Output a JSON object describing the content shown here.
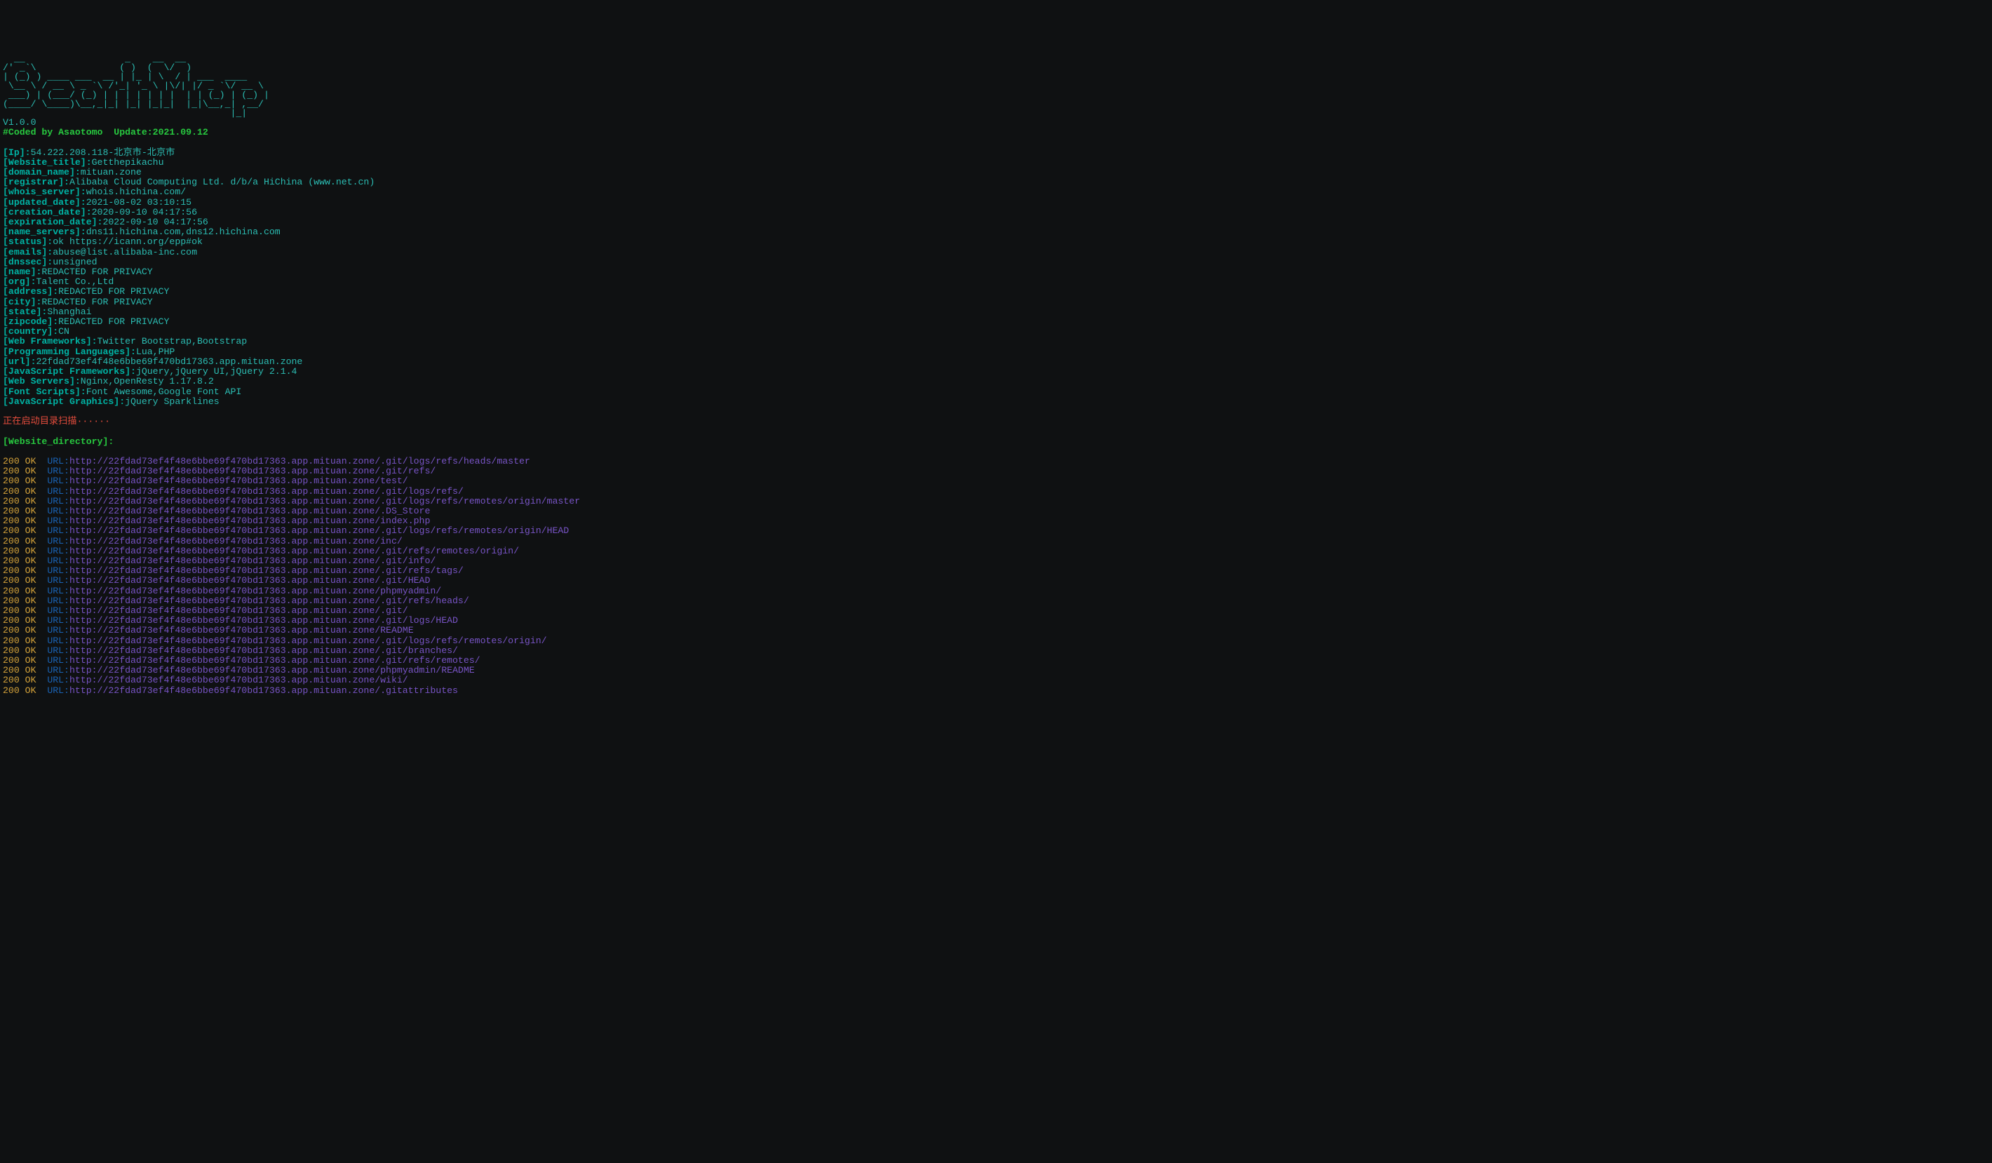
{
  "ascii_art": "  __                  _    __  __\n/' _`\\               ( )  (  \\/  )\n| (_) ) ____ ___  __ | |_ | \\  / | ___  ____\n \\__ \\ / __ \\ _ `\\ /'_| '_ \\ |\\/| |/ _ `\\/ __ \\\n ___) | (___/ (_) | | | | | | |  | | (_) | (_) |\n(____/ \\____)\\__,_|_| |_| |_|_|  |_|\\__,_| ,__/\n                                         |_|    ",
  "version": "V1.0.0",
  "coded_by": "#Coded by Asaotomo  Update:2021.09.12",
  "info_lines": [
    {
      "label": "[Ip]:",
      "value": "54.222.208.118-北京市-北京市"
    },
    {
      "label": "[Website_title]:",
      "value": "Getthepikachu"
    },
    {
      "label": "[domain_name]:",
      "value": "mituan.zone"
    },
    {
      "label": "[registrar]:",
      "value": "Alibaba Cloud Computing Ltd. d/b/a HiChina (www.net.cn)"
    },
    {
      "label": "[whois_server]:",
      "value": "whois.hichina.com/"
    },
    {
      "label": "[updated_date]:",
      "value": "2021-08-02 03:10:15"
    },
    {
      "label": "[creation_date]:",
      "value": "2020-09-10 04:17:56"
    },
    {
      "label": "[expiration_date]:",
      "value": "2022-09-10 04:17:56"
    },
    {
      "label": "[name_servers]:",
      "value": "dns11.hichina.com,dns12.hichina.com"
    },
    {
      "label": "[status]:",
      "value": "ok https://icann.org/epp#ok"
    },
    {
      "label": "[emails]:",
      "value": "abuse@list.alibaba-inc.com"
    },
    {
      "label": "[dnssec]:",
      "value": "unsigned"
    },
    {
      "label": "[name]:",
      "value": "REDACTED FOR PRIVACY"
    },
    {
      "label": "[org]:",
      "value": "Talent Co.,Ltd"
    },
    {
      "label": "[address]:",
      "value": "REDACTED FOR PRIVACY"
    },
    {
      "label": "[city]:",
      "value": "REDACTED FOR PRIVACY"
    },
    {
      "label": "[state]:",
      "value": "Shanghai"
    },
    {
      "label": "[zipcode]:",
      "value": "REDACTED FOR PRIVACY"
    },
    {
      "label": "[country]:",
      "value": "CN"
    },
    {
      "label": "[Web Frameworks]:",
      "value": "Twitter Bootstrap,Bootstrap"
    },
    {
      "label": "[Programming Languages]:",
      "value": "Lua,PHP"
    },
    {
      "label": "[url]:",
      "value": "22fdad73ef4f48e6bbe69f470bd17363.app.mituan.zone"
    },
    {
      "label": "[JavaScript Frameworks]:",
      "value": "jQuery,jQuery UI,jQuery 2.1.4"
    },
    {
      "label": "[Web Servers]:",
      "value": "Nginx,OpenResty 1.17.8.2"
    },
    {
      "label": "[Font Scripts]:",
      "value": "Font Awesome,Google Font API"
    },
    {
      "label": "[JavaScript Graphics]:",
      "value": "jQuery Sparklines"
    }
  ],
  "scan_msg": "正在启动目录扫描",
  "scan_dots": "······",
  "dir_label": "[Website_directory]:",
  "url_host": "22fdad73ef4f48e6bbe69f470bd17363.app.mituan.zone",
  "dir_entries": [
    {
      "status": "200 OK",
      "path": "/.git/logs/refs/heads/master"
    },
    {
      "status": "200 OK",
      "path": "/.git/refs/"
    },
    {
      "status": "200 OK",
      "path": "/test/"
    },
    {
      "status": "200 OK",
      "path": "/.git/logs/refs/"
    },
    {
      "status": "200 OK",
      "path": "/.git/logs/refs/remotes/origin/master"
    },
    {
      "status": "200 OK",
      "path": "/.DS_Store"
    },
    {
      "status": "200 OK",
      "path": "/index.php"
    },
    {
      "status": "200 OK",
      "path": "/.git/logs/refs/remotes/origin/HEAD"
    },
    {
      "status": "200 OK",
      "path": "/inc/"
    },
    {
      "status": "200 OK",
      "path": "/.git/refs/remotes/origin/"
    },
    {
      "status": "200 OK",
      "path": "/.git/info/"
    },
    {
      "status": "200 OK",
      "path": "/.git/refs/tags/"
    },
    {
      "status": "200 OK",
      "path": "/.git/HEAD"
    },
    {
      "status": "200 OK",
      "path": "/phpmyadmin/"
    },
    {
      "status": "200 OK",
      "path": "/.git/refs/heads/"
    },
    {
      "status": "200 OK",
      "path": "/.git/"
    },
    {
      "status": "200 OK",
      "path": "/.git/logs/HEAD"
    },
    {
      "status": "200 OK",
      "path": "/README"
    },
    {
      "status": "200 OK",
      "path": "/.git/logs/refs/remotes/origin/"
    },
    {
      "status": "200 OK",
      "path": "/.git/branches/"
    },
    {
      "status": "200 OK",
      "path": "/.git/refs/remotes/"
    },
    {
      "status": "200 OK",
      "path": "/phpmyadmin/README"
    },
    {
      "status": "200 OK",
      "path": "/wiki/"
    },
    {
      "status": "200 OK",
      "path": "/.gitattributes"
    }
  ]
}
